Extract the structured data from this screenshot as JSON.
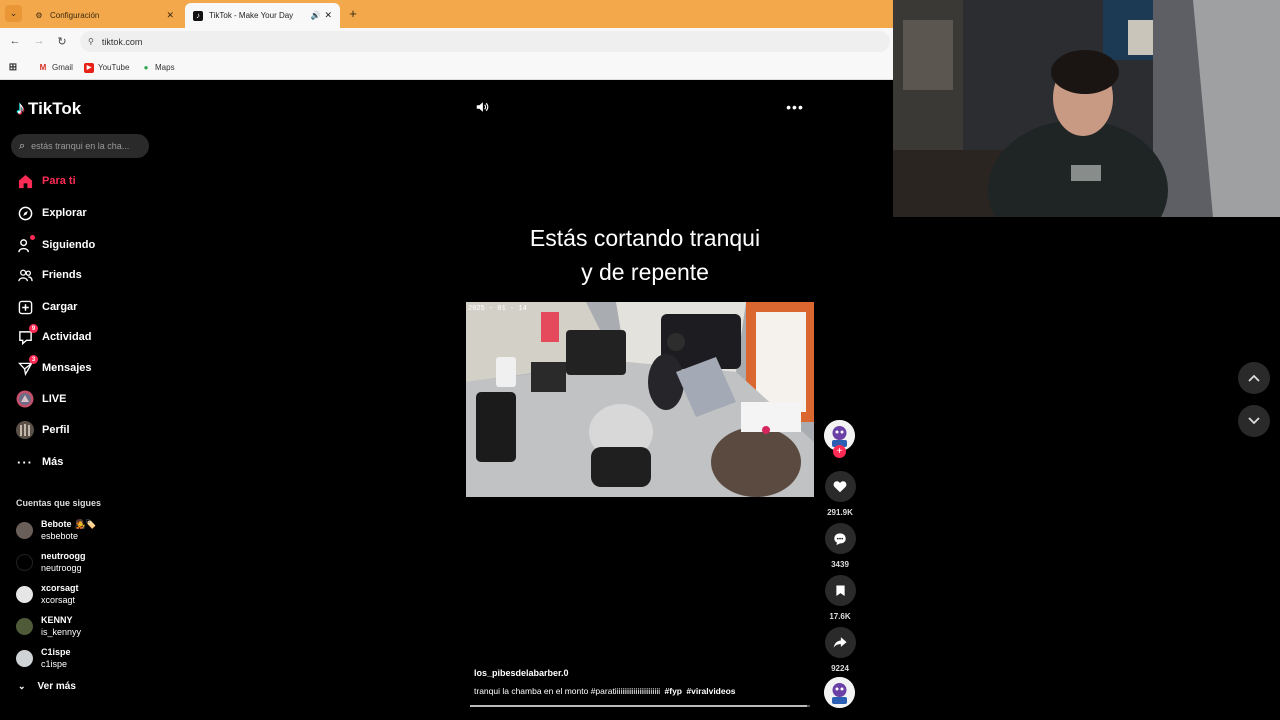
{
  "browser": {
    "tabs": [
      {
        "label": "Configuración",
        "icon": "gear-icon",
        "active": false
      },
      {
        "label": "TikTok - Make Your Day",
        "icon": "tiktok-icon",
        "active": true
      }
    ],
    "url": "tiktok.com",
    "bookmarks": [
      {
        "label": "Gmail",
        "icon": "gmail-icon"
      },
      {
        "label": "YouTube",
        "icon": "youtube-icon"
      },
      {
        "label": "Maps",
        "icon": "maps-pin-icon"
      }
    ]
  },
  "tiktok": {
    "logo": "TikTok",
    "search_placeholder": "estás tranqui en la cha...",
    "nav": [
      {
        "label": "Para ti",
        "icon": "home-icon",
        "active": true
      },
      {
        "label": "Explorar",
        "icon": "compass-icon"
      },
      {
        "label": "Siguiendo",
        "icon": "following-icon"
      },
      {
        "label": "Friends",
        "icon": "friends-icon"
      },
      {
        "label": "Cargar",
        "icon": "upload-icon"
      },
      {
        "label": "Actividad",
        "icon": "activity-icon",
        "badge": "9"
      },
      {
        "label": "Mensajes",
        "icon": "messages-icon",
        "badge": "3"
      },
      {
        "label": "LIVE",
        "icon": "live-icon"
      },
      {
        "label": "Perfil",
        "icon": "profile-avatar"
      },
      {
        "label": "Más",
        "icon": "more-dots-icon"
      }
    ],
    "following_title": "Cuentas que sigues",
    "following": [
      {
        "name": "Bebote 🧑‍🎤🏷️",
        "handle": "esbebote"
      },
      {
        "name": "neutroogg",
        "handle": "neutroogg"
      },
      {
        "name": "xcorsagt",
        "handle": "xcorsagt"
      },
      {
        "name": "KENNY",
        "handle": "is_kennyy"
      },
      {
        "name": "C1ispe",
        "handle": "c1ispe"
      }
    ],
    "see_more": "Ver más"
  },
  "video": {
    "caption_line1": "Estás cortando tranqui",
    "caption_line2": "y de repente",
    "cctv_timestamp": "2025 - 01 - 14",
    "author": "los_pibesdelabarber.0",
    "description": "tranqui la chamba en el monto #paratiiiiiiiiiiiiiiiiiiiiiiii",
    "tags": [
      "#fyp",
      "#viralvideos"
    ],
    "progress": 0.99,
    "likes": "291.9K",
    "comments": "3439",
    "saves": "17.6K",
    "shares": "9224"
  },
  "colors": {
    "accent": "#fe2c55",
    "tabbar": "#f3a84b",
    "background": "#000000"
  }
}
